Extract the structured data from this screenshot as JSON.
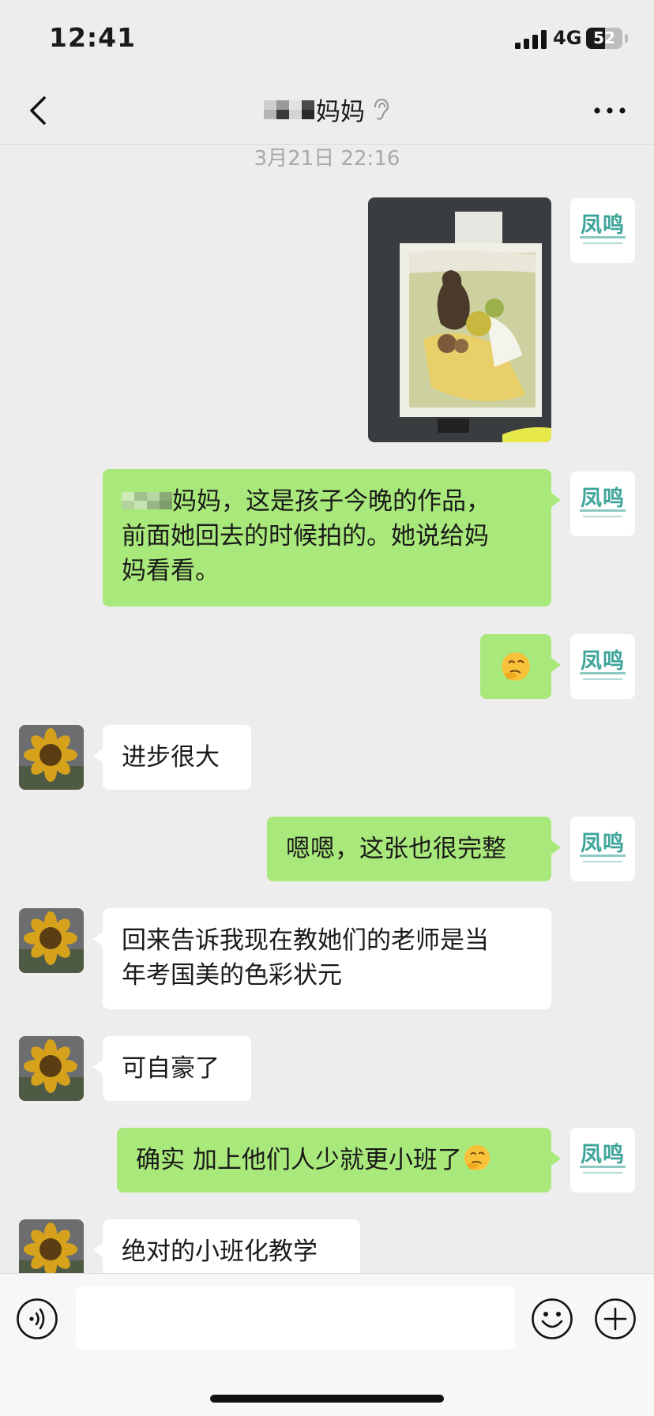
{
  "status_bar": {
    "time": "12:41",
    "network": "4G",
    "battery": "52",
    "battery_level": 0.52
  },
  "nav": {
    "title": "妈妈",
    "back_icon": "chevron-left-icon",
    "more_icon": "more-icon",
    "earpiece_icon": "ear-icon"
  },
  "chat": {
    "timestamp": "3月21日 22:16",
    "me_logo_text": "凤鸣",
    "messages": [
      {
        "from": "me",
        "type": "image"
      },
      {
        "from": "me",
        "type": "text",
        "text_lines": [
          "妈妈，这是孩子今晚的作品，",
          "前面她回去的时候拍的。她说给妈",
          "妈看看。"
        ]
      },
      {
        "from": "me",
        "type": "emoji"
      },
      {
        "from": "them",
        "type": "text",
        "text": "进步很大"
      },
      {
        "from": "me",
        "type": "text",
        "text": "嗯嗯，这张也很完整"
      },
      {
        "from": "them",
        "type": "text",
        "text_lines": [
          "回来告诉我现在教她们的老师是当",
          "年考国美的色彩状元"
        ]
      },
      {
        "from": "them",
        "type": "text",
        "text": "可自豪了"
      },
      {
        "from": "me",
        "type": "text",
        "text": "确实 加上他们人少就更小班了"
      },
      {
        "from": "them",
        "type": "text",
        "text": "绝对的小班化教学"
      }
    ]
  },
  "input_bar": {
    "placeholder": "",
    "voice_icon": "voice-icon",
    "emoji_icon": "smiley-icon",
    "plus_icon": "plus-icon"
  },
  "colors": {
    "background": "#ededed",
    "me_bubble": "#a9e97b",
    "them_bubble": "#ffffff",
    "logo": "#3fa59a"
  }
}
